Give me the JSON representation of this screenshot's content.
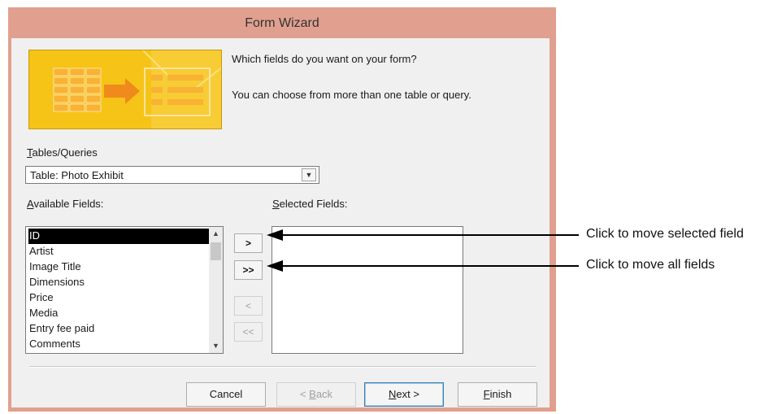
{
  "window": {
    "title": "Form Wizard"
  },
  "intro": {
    "question": "Which fields do you want on your form?",
    "hint": "You can choose from more than one table or query."
  },
  "tables": {
    "label_key": "T",
    "label_rest": "ables/Queries",
    "selected": "Table: Photo Exhibit"
  },
  "available": {
    "label_key": "A",
    "label_rest": "vailable Fields:",
    "items": [
      "ID",
      "Artist",
      "Image Title",
      "Dimensions",
      "Price",
      "Media",
      "Entry fee paid",
      "Comments"
    ],
    "selected_index": 0
  },
  "selected_fields": {
    "label_key": "S",
    "label_rest": "elected Fields:"
  },
  "move_buttons": {
    "move_one": ">",
    "move_all": ">>",
    "remove_one": "<",
    "remove_all": "<<"
  },
  "footer": {
    "cancel": "Cancel",
    "back_pre": "< ",
    "back_key": "B",
    "back_rest": "ack",
    "next_key": "N",
    "next_rest": "ext >",
    "finish_key": "F",
    "finish_rest": "inish"
  },
  "callouts": {
    "move_selected": "Click to move selected field",
    "move_all": "Click to move all fields"
  }
}
